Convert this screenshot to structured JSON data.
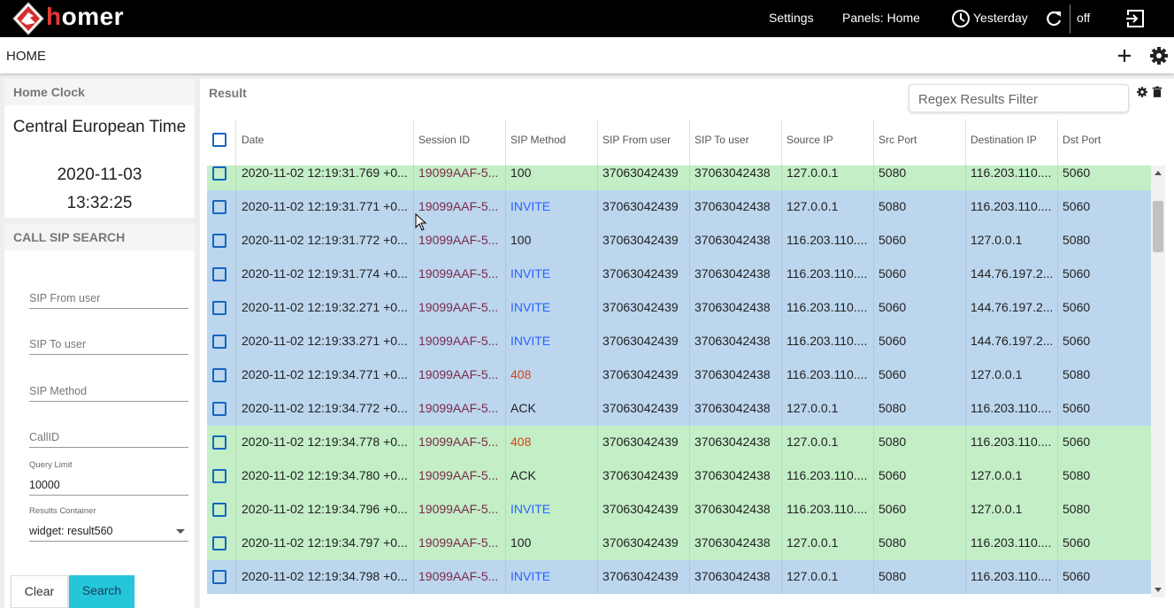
{
  "app": {
    "brand_h": "h",
    "brand_rest": "omer",
    "accent": "#e53935"
  },
  "topbar": {
    "settings": "Settings",
    "panels": "Panels: Home",
    "time": "Yesterday",
    "refresh_state": "off"
  },
  "header": {
    "title": "HOME"
  },
  "clock": {
    "title": "Home Clock",
    "timezone": "Central European Time",
    "date": "2020-11-03",
    "time": "13:32:25"
  },
  "search": {
    "title": "CALL SIP SEARCH",
    "from_placeholder": "SIP From user",
    "to_placeholder": "SIP To user",
    "method_placeholder": "SIP Method",
    "callid_placeholder": "CallID",
    "limit_label": "Query Limit",
    "limit_value": "10000",
    "container_label": "Results Container",
    "container_value": "widget: result560",
    "clear": "Clear",
    "search": "Search"
  },
  "result": {
    "title": "Result",
    "filter_placeholder": "Regex Results Filter",
    "columns": [
      "Date",
      "Session ID",
      "SIP Method",
      "SIP From user",
      "SIP To user",
      "Source IP",
      "Src Port",
      "Destination IP",
      "Dst Port"
    ],
    "colors": {
      "green": "#c3eec6",
      "blue": "#bcd6ee",
      "session": "#7b2a4b",
      "invite": "#2962ff",
      "error": "#d84315"
    },
    "rows": [
      {
        "bg": "green",
        "date": "2020-11-02 12:19:31.769 +0...",
        "session": "19099AAF-5...",
        "method": "100",
        "mtype": "normal",
        "from": "37063042439",
        "to": "37063042438",
        "src": "127.0.0.1",
        "sport": "5080",
        "dst": "116.203.110....",
        "dport": "5060"
      },
      {
        "bg": "blue",
        "date": "2020-11-02 12:19:31.771 +0...",
        "session": "19099AAF-5...",
        "method": "INVITE",
        "mtype": "invite",
        "from": "37063042439",
        "to": "37063042438",
        "src": "127.0.0.1",
        "sport": "5080",
        "dst": "116.203.110....",
        "dport": "5060"
      },
      {
        "bg": "blue",
        "date": "2020-11-02 12:19:31.772 +0...",
        "session": "19099AAF-5...",
        "method": "100",
        "mtype": "normal",
        "from": "37063042439",
        "to": "37063042438",
        "src": "116.203.110....",
        "sport": "5060",
        "dst": "127.0.0.1",
        "dport": "5080"
      },
      {
        "bg": "blue",
        "date": "2020-11-02 12:19:31.774 +0...",
        "session": "19099AAF-5...",
        "method": "INVITE",
        "mtype": "invite",
        "from": "37063042439",
        "to": "37063042438",
        "src": "116.203.110....",
        "sport": "5060",
        "dst": "144.76.197.2...",
        "dport": "5060"
      },
      {
        "bg": "blue",
        "date": "2020-11-02 12:19:32.271 +0...",
        "session": "19099AAF-5...",
        "method": "INVITE",
        "mtype": "invite",
        "from": "37063042439",
        "to": "37063042438",
        "src": "116.203.110....",
        "sport": "5060",
        "dst": "144.76.197.2...",
        "dport": "5060"
      },
      {
        "bg": "blue",
        "date": "2020-11-02 12:19:33.271 +0...",
        "session": "19099AAF-5...",
        "method": "INVITE",
        "mtype": "invite",
        "from": "37063042439",
        "to": "37063042438",
        "src": "116.203.110....",
        "sport": "5060",
        "dst": "144.76.197.2...",
        "dport": "5060"
      },
      {
        "bg": "blue",
        "date": "2020-11-02 12:19:34.771 +0...",
        "session": "19099AAF-5...",
        "method": "408",
        "mtype": "error",
        "from": "37063042439",
        "to": "37063042438",
        "src": "116.203.110....",
        "sport": "5060",
        "dst": "127.0.0.1",
        "dport": "5080"
      },
      {
        "bg": "blue",
        "date": "2020-11-02 12:19:34.772 +0...",
        "session": "19099AAF-5...",
        "method": "ACK",
        "mtype": "normal",
        "from": "37063042439",
        "to": "37063042438",
        "src": "127.0.0.1",
        "sport": "5080",
        "dst": "116.203.110....",
        "dport": "5060"
      },
      {
        "bg": "green",
        "date": "2020-11-02 12:19:34.778 +0...",
        "session": "19099AAF-5...",
        "method": "408",
        "mtype": "error",
        "from": "37063042439",
        "to": "37063042438",
        "src": "127.0.0.1",
        "sport": "5080",
        "dst": "116.203.110....",
        "dport": "5060"
      },
      {
        "bg": "green",
        "date": "2020-11-02 12:19:34.780 +0...",
        "session": "19099AAF-5...",
        "method": "ACK",
        "mtype": "normal",
        "from": "37063042439",
        "to": "37063042438",
        "src": "116.203.110....",
        "sport": "5060",
        "dst": "127.0.0.1",
        "dport": "5080"
      },
      {
        "bg": "green",
        "date": "2020-11-02 12:19:34.796 +0...",
        "session": "19099AAF-5...",
        "method": "INVITE",
        "mtype": "invite",
        "from": "37063042439",
        "to": "37063042438",
        "src": "116.203.110....",
        "sport": "5060",
        "dst": "127.0.0.1",
        "dport": "5080"
      },
      {
        "bg": "green",
        "date": "2020-11-02 12:19:34.797 +0...",
        "session": "19099AAF-5...",
        "method": "100",
        "mtype": "normal",
        "from": "37063042439",
        "to": "37063042438",
        "src": "127.0.0.1",
        "sport": "5080",
        "dst": "116.203.110....",
        "dport": "5060"
      },
      {
        "bg": "blue",
        "date": "2020-11-02 12:19:34.798 +0...",
        "session": "19099AAF-5...",
        "method": "INVITE",
        "mtype": "invite",
        "from": "37063042439",
        "to": "37063042438",
        "src": "127.0.0.1",
        "sport": "5080",
        "dst": "116.203.110....",
        "dport": "5060"
      }
    ]
  }
}
